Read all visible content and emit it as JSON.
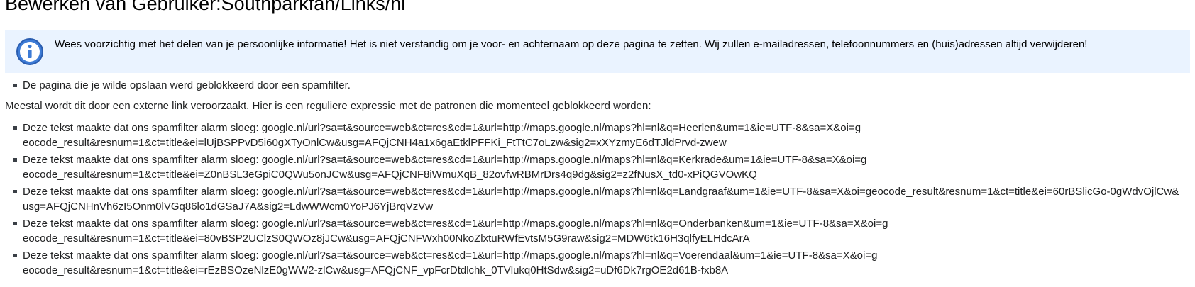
{
  "page": {
    "title": "Bewerken van Gebruiker:Southparkfan/Links/nl"
  },
  "notice": {
    "icon": "info-icon",
    "color": "#eaf3ff",
    "text": "Wees voorzichtig met het delen van je persoonlijke informatie! Het is niet verstandig om je voor- en achternaam op deze pagina te zetten. Wij zullen e-mailadressen, telefoonnummers en (huis)adressen altijd verwijderen!"
  },
  "blocked_message": "De pagina die je wilde opslaan werd geblokkeerd door een spamfilter.",
  "explanation": "Meestal wordt dit door een externe link veroorzaakt. Hier is een reguliere expressie met de patronen die momenteel geblokkeerd worden:",
  "matches": [
    "Deze tekst maakte dat ons spamfilter alarm sloeg: google.nl/url?sa=t&source=web&ct=res&cd=1&url=http://maps.google.nl/maps?hl=nl&q=Heerlen&um=1&ie=UTF-8&sa=X&oi=geocode_result&resnum=1&ct=title&ei=lUjBSPPvD5i60gXTyOnlCw&usg=AFQjCNH4a1x6gaEtklPFFKi_FtTtC7oLzw&sig2=xXYzmyE6dTJldPrvd-zwew",
    "Deze tekst maakte dat ons spamfilter alarm sloeg: google.nl/url?sa=t&source=web&ct=res&cd=1&url=http://maps.google.nl/maps?hl=nl&q=Kerkrade&um=1&ie=UTF-8&sa=X&oi=geocode_result&resnum=1&ct=title&ei=Z0nBSL3eGpiC0QWu5onJCw&usg=AFQjCNF8iWmuXqB_82ovfwRBMrDrs4q9dg&sig2=z2fNusX_td0-xPiQGVOwKQ",
    "Deze tekst maakte dat ons spamfilter alarm sloeg: google.nl/url?sa=t&source=web&ct=res&cd=1&url=http://maps.google.nl/maps?hl=nl&q=Landgraaf&um=1&ie=UTF-8&sa=X&oi=geocode_result&resnum=1&ct=title&ei=60rBSlicGo-0gWdvOjlCw&usg=AFQjCNHnVh6zI5Onm0lVGq86lo1dGSaJ7A&sig2=LdwWWcm0YoPJ6YjBrqVzVw",
    "Deze tekst maakte dat ons spamfilter alarm sloeg: google.nl/url?sa=t&source=web&ct=res&cd=1&url=http://maps.google.nl/maps?hl=nl&q=Onderbanken&um=1&ie=UTF-8&sa=X&oi=geocode_result&resnum=1&ct=title&ei=80vBSP2UClzS0QWOz8jJCw&usg=AFQjCNFWxh00NkoZlxtuRWfEvtsM5G9raw&sig2=MDW6tk16H3qlfyELHdcArA",
    "Deze tekst maakte dat ons spamfilter alarm sloeg: google.nl/url?sa=t&source=web&ct=res&cd=1&url=http://maps.google.nl/maps?hl=nl&q=Voerendaal&um=1&ie=UTF-8&sa=X&oi=geocode_result&resnum=1&ct=title&ei=rEzBSOzeNlzE0gWW2-zlCw&usg=AFQjCNF_vpFcrDtdlchk_0TVlukq0HtSdw&sig2=uDf6Dk7rgOE2d61B-fxb8A"
  ]
}
